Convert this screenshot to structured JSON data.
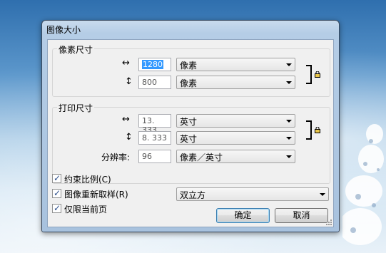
{
  "window": {
    "title": "图像大小"
  },
  "pixel_dims": {
    "group_title": "像素尺寸",
    "width_icon": "horizontal-arrow-icon",
    "width_value": "1280",
    "width_unit": "像素",
    "height_icon": "vertical-arrow-icon",
    "height_value": "800",
    "height_unit": "像素",
    "link_icon": "lock-icon"
  },
  "print_size": {
    "group_title": "打印尺寸",
    "width_value": "13. 333",
    "width_unit": "英寸",
    "height_value": "8. 333",
    "height_unit": "英寸",
    "resolution_label": "分辨率:",
    "resolution_value": "96",
    "resolution_unit": "像素／英寸",
    "link_icon": "lock-icon"
  },
  "options": {
    "constrain_label": "约束比例(C)",
    "constrain_checked": true,
    "resample_label": "图像重新取样(R)",
    "resample_checked": true,
    "resample_method": "双立方",
    "current_page_label": "仅限当前页",
    "current_page_checked": true
  },
  "buttons": {
    "ok": "确定",
    "cancel": "取消"
  },
  "glyphs": {
    "h_arrow": "↔",
    "v_arrow": "↕",
    "check": "✓"
  }
}
